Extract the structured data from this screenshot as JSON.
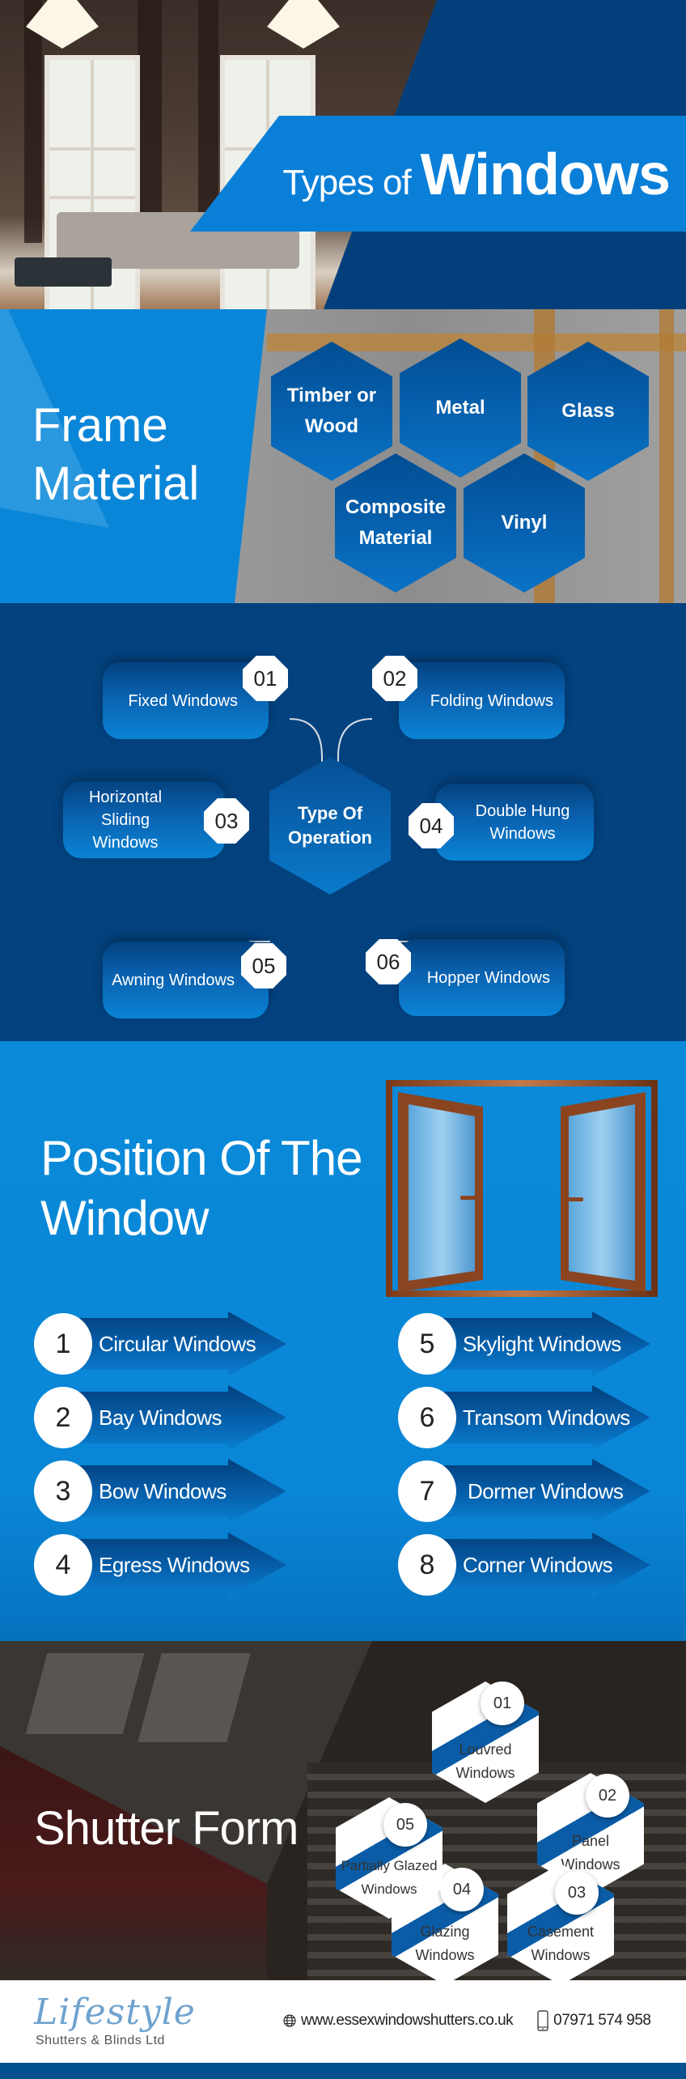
{
  "header": {
    "title_light": "Types of",
    "title_bold": "Windows"
  },
  "frame_material": {
    "heading_line1": "Frame",
    "heading_line2": "Material",
    "items": [
      {
        "label": "Timber or Wood"
      },
      {
        "label": "Metal"
      },
      {
        "label": "Glass"
      },
      {
        "label": "Composite Material"
      },
      {
        "label": "Vinyl"
      }
    ]
  },
  "operation": {
    "center_line1": "Type Of",
    "center_line2": "Operation",
    "items": [
      {
        "num": "01",
        "label": "Fixed Windows"
      },
      {
        "num": "02",
        "label": "Folding Windows"
      },
      {
        "num": "03",
        "label": "Horizontal Sliding Windows"
      },
      {
        "num": "04",
        "label": "Double Hung Windows"
      },
      {
        "num": "05",
        "label": "Awning Windows"
      },
      {
        "num": "06",
        "label": "Hopper Windows"
      }
    ]
  },
  "position": {
    "heading_line1": "Position Of The",
    "heading_line2": "Window",
    "items": [
      {
        "num": "1",
        "label": "Circular Windows"
      },
      {
        "num": "2",
        "label": "Bay Windows"
      },
      {
        "num": "3",
        "label": "Bow Windows"
      },
      {
        "num": "4",
        "label": "Egress Windows"
      },
      {
        "num": "5",
        "label": "Skylight Windows"
      },
      {
        "num": "6",
        "label": "Transom Windows"
      },
      {
        "num": "7",
        "label": "Dormer Windows"
      },
      {
        "num": "8",
        "label": "Corner Windows"
      }
    ]
  },
  "shutter": {
    "heading": "Shutter Form",
    "items": [
      {
        "num": "01",
        "line1": "Louvred",
        "line2": "Windows"
      },
      {
        "num": "02",
        "line1": "Panel",
        "line2": "Windows"
      },
      {
        "num": "03",
        "line1": "Casement",
        "line2": "Windows"
      },
      {
        "num": "04",
        "line1": "Glazing",
        "line2": "Windows"
      },
      {
        "num": "05",
        "line1": "Partially Glazed",
        "line2": "Windows"
      }
    ]
  },
  "footer": {
    "logo_script": "Lifestyle",
    "logo_sub": "Shutters & Blinds Ltd",
    "website": "www.essexwindowshutters.co.uk",
    "phone": "07971 574 958",
    "icons": {
      "website": "globe-icon",
      "phone": "mobile-phone-icon"
    }
  },
  "colors": {
    "dark_blue": "#03427f",
    "bright_blue": "#0a86d8",
    "accent_blue": "#0a7fd8",
    "logo_blue": "#6fa3cf",
    "footer_bar": "#03518f"
  }
}
